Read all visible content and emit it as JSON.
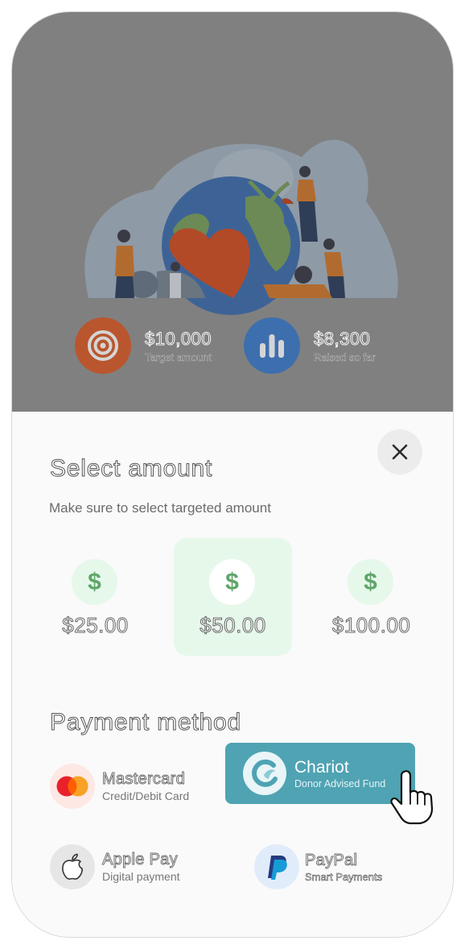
{
  "stats": {
    "target": {
      "value": "$10,000",
      "label": "Target amount"
    },
    "raised": {
      "value": "$8,300",
      "label": "Raised so far"
    }
  },
  "sheet": {
    "title": "Select amount",
    "subtitle": "Make sure to select targeted amount"
  },
  "amounts": [
    {
      "symbol": "$",
      "label": "$25.00",
      "selected": false
    },
    {
      "symbol": "$",
      "label": "$50.00",
      "selected": true
    },
    {
      "symbol": "$",
      "label": "$100.00",
      "selected": false
    }
  ],
  "payment": {
    "title": "Payment method",
    "methods": [
      {
        "name": "Mastercard",
        "desc": "Credit/Debit Card",
        "icon": "mastercard-icon"
      },
      {
        "name": "Chariot",
        "desc": "Donor Advised Fund",
        "icon": "chariot-icon",
        "selected": true
      },
      {
        "name": "Apple Pay",
        "desc": "Digital payment",
        "icon": "apple-icon"
      },
      {
        "name": "PayPal",
        "desc": "Smart Payments",
        "icon": "paypal-icon"
      }
    ]
  },
  "colors": {
    "target": "#c3552e",
    "raised": "#3d6fae",
    "selected_amount_bg": "#e6f8ea",
    "dollar_green": "#5fa56a",
    "chariot": "#4fa3b3"
  }
}
